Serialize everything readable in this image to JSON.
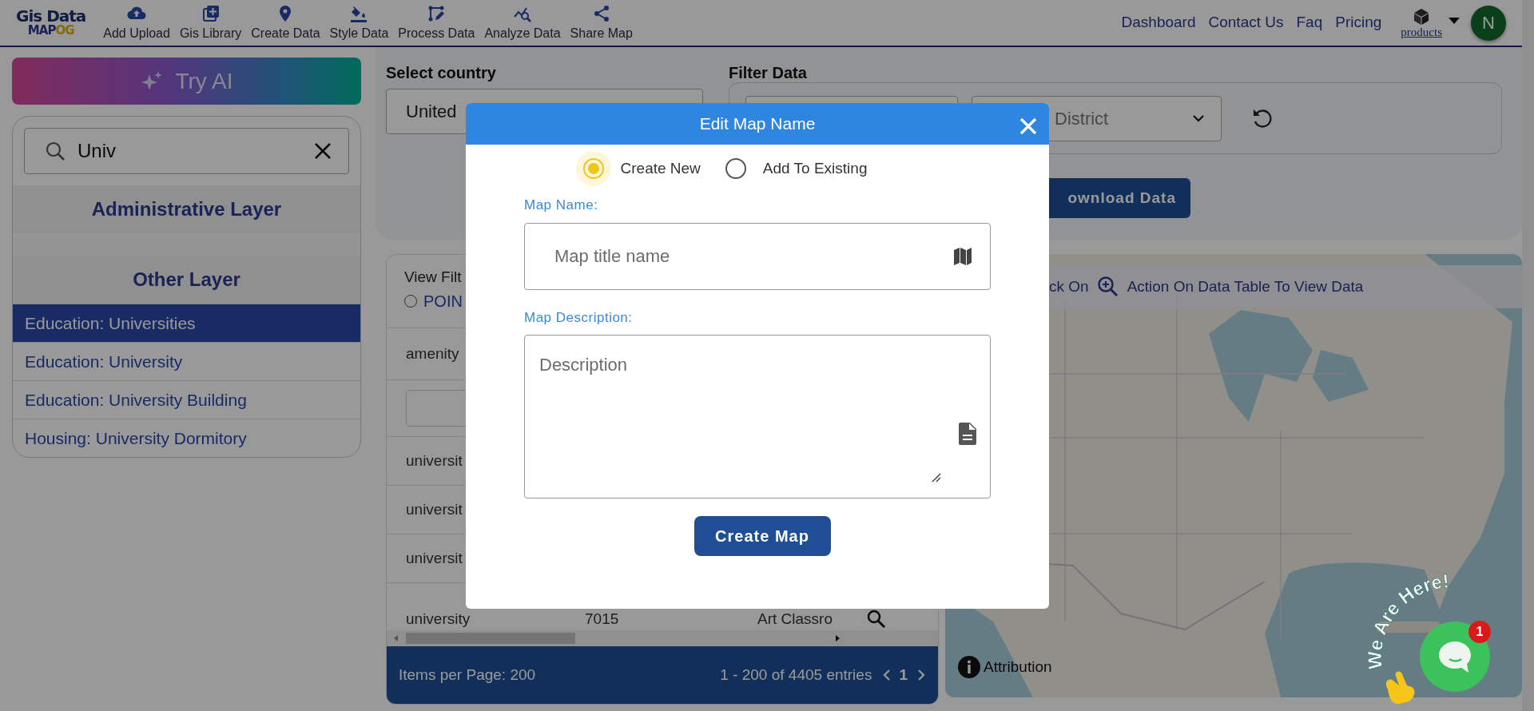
{
  "navbar": {
    "logo": {
      "title": "Gis Data",
      "subtitle": "MAP",
      "subtitle_accent": "OG"
    },
    "tools": [
      "Add Upload",
      "Gis Library",
      "Create Data",
      "Style Data",
      "Process Data",
      "Analyze Data",
      "Share Map"
    ],
    "links": [
      "Dashboard",
      "Contact Us",
      "Faq",
      "Pricing"
    ],
    "products": {
      "label": "products"
    },
    "avatar": {
      "initial": "N"
    }
  },
  "sidebar": {
    "try_ai": "Try AI",
    "search": {
      "value": "Univ"
    },
    "sections": [
      {
        "heading": "Administrative Layer"
      },
      {
        "heading": "Other Layer",
        "items": [
          {
            "label": "Education: Universities",
            "selected": true
          },
          {
            "label": "Education: University",
            "selected": false
          },
          {
            "label": "Education: University Building",
            "selected": false
          },
          {
            "label": "Housing: University Dormitory",
            "selected": false
          }
        ]
      }
    ]
  },
  "filters": {
    "country_label": "Select country",
    "country_value": "United",
    "filter_label": "Filter Data",
    "district_text": "District",
    "download": "ownload Data"
  },
  "table": {
    "title": "View Filt",
    "geometry_option": {
      "label": "POIN",
      "selected": false
    },
    "column_1_header": "amenity",
    "rows": [
      [
        "universit"
      ],
      [
        "universit"
      ],
      [
        "universit"
      ],
      [
        "university",
        "7015",
        "Art Classro"
      ]
    ],
    "footer": {
      "items_per_page": "Items per Page: 200",
      "range": "1 - 200 of 4405 entries",
      "page": "1"
    }
  },
  "map": {
    "hint_prefix": "ck On",
    "hint": "Action On Data Table To View Data",
    "attribution": "Attribution"
  },
  "chat": {
    "banner": "We Are Here!",
    "badge": "1"
  },
  "modal": {
    "title": "Edit Map Name",
    "modes": [
      {
        "label": "Create New",
        "selected": true
      },
      {
        "label": "Add To Existing",
        "selected": false
      }
    ],
    "name_field": {
      "label": "Map Name:",
      "placeholder": "Map title name"
    },
    "description_field": {
      "label": "Map Description:",
      "placeholder": "Description"
    },
    "submit": "Create Map"
  }
}
